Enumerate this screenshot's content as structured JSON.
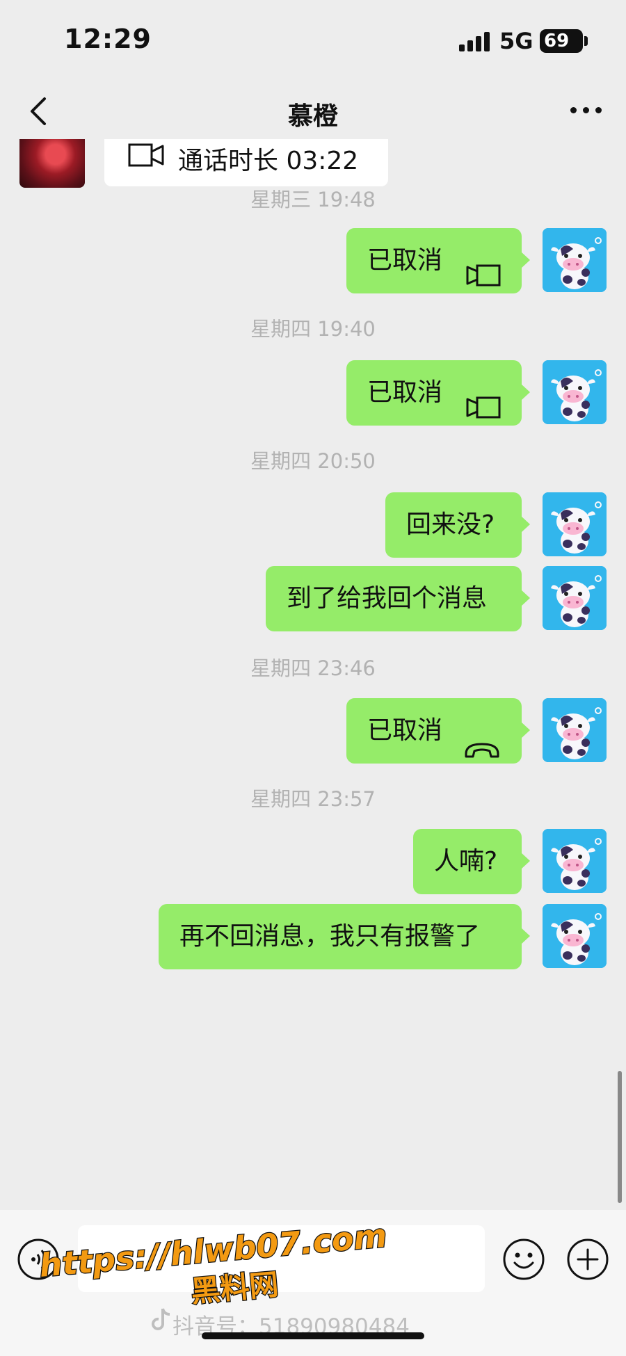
{
  "status_bar": {
    "time": "12:29",
    "network": "5G",
    "battery": "69"
  },
  "header": {
    "title": "慕橙"
  },
  "messages": {
    "call_duration": "通话时长 03:22",
    "ts1": "星期三 19:48",
    "msg1": "已取消",
    "ts2": "星期四 19:40",
    "msg2": "已取消",
    "ts3": "星期四 20:50",
    "msg3": "回来没?",
    "msg4": "到了给我回个消息",
    "ts4": "星期四 23:46",
    "msg5": "已取消",
    "ts5": "星期四 23:57",
    "msg6": "人喃?",
    "msg7": "再不回消息，我只有报警了"
  },
  "watermark": {
    "url": "https://hlwb07.com",
    "site": "黑料网",
    "tiktok_id": "抖音号：51890980484"
  },
  "icons": {
    "back": "chevron-left-icon",
    "more": "more-dots-icon",
    "video_call": "video-camera-icon",
    "voice_call": "phone-handset-icon",
    "voice_input": "voice-wave-icon",
    "emoji": "emoji-face-icon",
    "plus": "plus-circle-icon"
  },
  "colors": {
    "background": "#ededed",
    "outgoing_bubble": "#95ec69",
    "incoming_bubble": "#ffffff",
    "timestamp": "#b2b2b2",
    "avatar_bg": "#32b6ec",
    "watermark_orange": "#f39a12"
  }
}
